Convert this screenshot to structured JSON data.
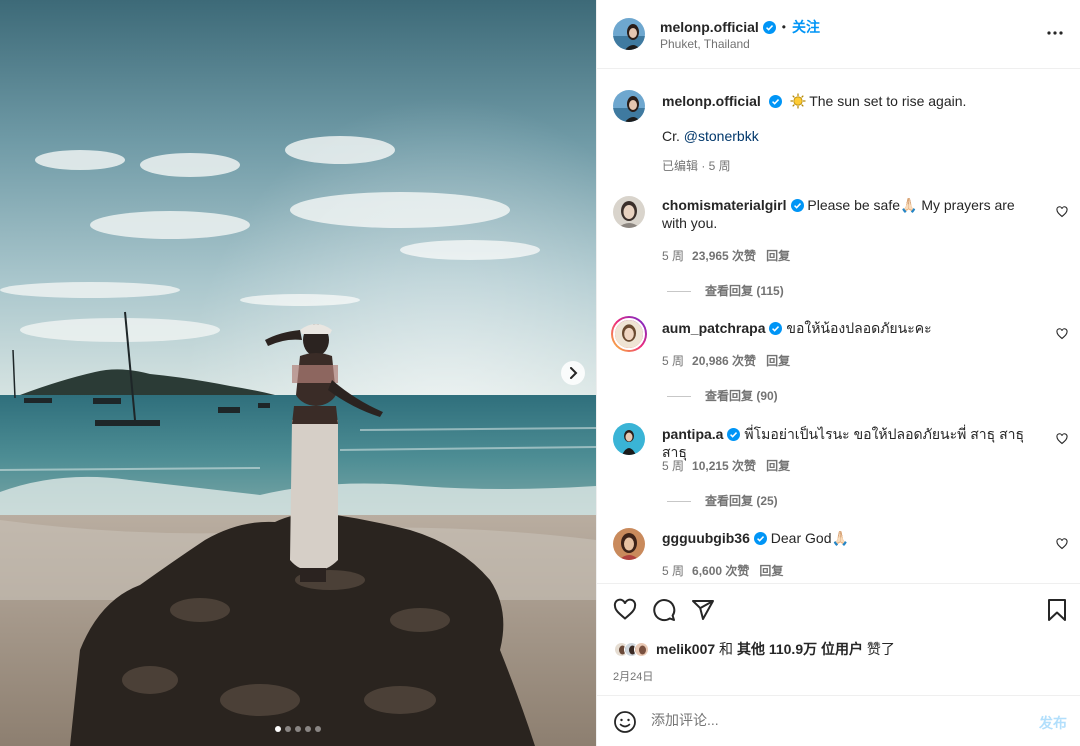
{
  "post": {
    "username": "melonp.official",
    "follow_label": "关注",
    "location": "Phuket, Thailand",
    "caption": "The sun set to rise again.",
    "credit_prefix": "Cr. ",
    "credit_handle": "@stonerbkk",
    "edited": "已编辑 · 5 周",
    "photo_count": 5,
    "photo_index": 1
  },
  "comments": [
    {
      "user": "chomismaterialgirl",
      "text": "Please be safe🙏🏻 My prayers are with you.",
      "age": "5 周",
      "likes": "23,965 次赞",
      "reply": "回复",
      "view_replies": "查看回复 (115)"
    },
    {
      "user": "aum_patchrapa",
      "text": "ขอให้น้องปลอดภัยนะคะ",
      "age": "5 周",
      "likes": "20,986 次赞",
      "reply": "回复",
      "view_replies": "查看回复 (90)"
    },
    {
      "user": "pantipa.a",
      "text": "พี่โมอย่าเป็นไรนะ ขอให้ปลอดภัยนะพี่ สาธุ สาธุ สาธุ",
      "age": "5 周",
      "likes": "10,215 次赞",
      "reply": "回复",
      "view_replies": "查看回复 (25)"
    },
    {
      "user": "ggguubgib36",
      "text": "Dear God🙏🏻",
      "age": "5 周",
      "likes": "6,600 次赞",
      "reply": "回复"
    }
  ],
  "likes_line": {
    "user": "melik007",
    "and": " 和 ",
    "others": "其他 110.9万 位用户",
    "suffix": " 赞了"
  },
  "date": "2月24日",
  "add_comment": {
    "placeholder": "添加评论...",
    "post_label": "发布"
  },
  "colors": {
    "accent": "#0095f6",
    "verified": "#0095f6",
    "muted": "#737373"
  }
}
